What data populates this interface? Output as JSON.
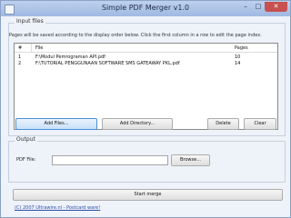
{
  "window": {
    "title": "Simple PDF Merger v1.0"
  },
  "titlebar_buttons": {
    "minimize": "–",
    "maximize": "□",
    "close": "✕"
  },
  "input_files": {
    "group_label": "Input files",
    "hint": "Pages will be saved according to the display order below. Click the first column in a row to edit the page index.",
    "columns": [
      "#",
      "File",
      "Pages"
    ],
    "rows": [
      {
        "num": "1",
        "file": "F:\\Modul Pemrograman API.pdf",
        "pages": "10"
      },
      {
        "num": "2",
        "file": "F:\\TUTORIAL PENGGUNAAN SOFTWARE SMS GATEAWAY PKL.pdf",
        "pages": "14"
      }
    ],
    "buttons": {
      "add_files": "Add Files...",
      "add_directory": "Add Directory...",
      "delete": "Delete",
      "clear": "Clear"
    }
  },
  "output": {
    "group_label": "Output",
    "pdf_file_label": "PDF File:",
    "pdf_file_value": "",
    "browse_label": "Browse..."
  },
  "start_merge_label": "Start merge",
  "copyright_link": "(C) 2007 Ultrawire.nl - Postcard ware!"
}
